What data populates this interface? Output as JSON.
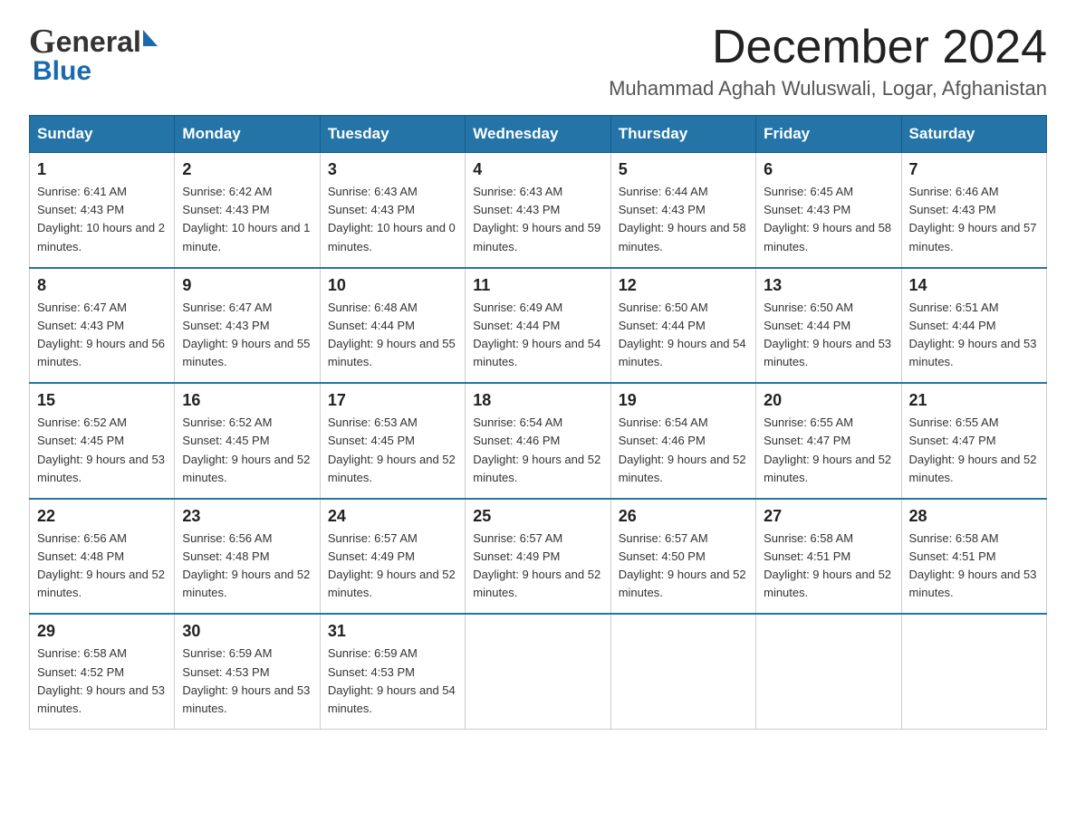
{
  "header": {
    "logo_g": "G",
    "logo_eneral": "eneral",
    "logo_blue": "Blue",
    "month_title": "December 2024",
    "location": "Muhammad Aghah Wuluswali, Logar, Afghanistan"
  },
  "weekdays": [
    "Sunday",
    "Monday",
    "Tuesday",
    "Wednesday",
    "Thursday",
    "Friday",
    "Saturday"
  ],
  "weeks": [
    [
      {
        "day": "1",
        "sunrise": "6:41 AM",
        "sunset": "4:43 PM",
        "daylight": "10 hours and 2 minutes."
      },
      {
        "day": "2",
        "sunrise": "6:42 AM",
        "sunset": "4:43 PM",
        "daylight": "10 hours and 1 minute."
      },
      {
        "day": "3",
        "sunrise": "6:43 AM",
        "sunset": "4:43 PM",
        "daylight": "10 hours and 0 minutes."
      },
      {
        "day": "4",
        "sunrise": "6:43 AM",
        "sunset": "4:43 PM",
        "daylight": "9 hours and 59 minutes."
      },
      {
        "day": "5",
        "sunrise": "6:44 AM",
        "sunset": "4:43 PM",
        "daylight": "9 hours and 58 minutes."
      },
      {
        "day": "6",
        "sunrise": "6:45 AM",
        "sunset": "4:43 PM",
        "daylight": "9 hours and 58 minutes."
      },
      {
        "day": "7",
        "sunrise": "6:46 AM",
        "sunset": "4:43 PM",
        "daylight": "9 hours and 57 minutes."
      }
    ],
    [
      {
        "day": "8",
        "sunrise": "6:47 AM",
        "sunset": "4:43 PM",
        "daylight": "9 hours and 56 minutes."
      },
      {
        "day": "9",
        "sunrise": "6:47 AM",
        "sunset": "4:43 PM",
        "daylight": "9 hours and 55 minutes."
      },
      {
        "day": "10",
        "sunrise": "6:48 AM",
        "sunset": "4:44 PM",
        "daylight": "9 hours and 55 minutes."
      },
      {
        "day": "11",
        "sunrise": "6:49 AM",
        "sunset": "4:44 PM",
        "daylight": "9 hours and 54 minutes."
      },
      {
        "day": "12",
        "sunrise": "6:50 AM",
        "sunset": "4:44 PM",
        "daylight": "9 hours and 54 minutes."
      },
      {
        "day": "13",
        "sunrise": "6:50 AM",
        "sunset": "4:44 PM",
        "daylight": "9 hours and 53 minutes."
      },
      {
        "day": "14",
        "sunrise": "6:51 AM",
        "sunset": "4:44 PM",
        "daylight": "9 hours and 53 minutes."
      }
    ],
    [
      {
        "day": "15",
        "sunrise": "6:52 AM",
        "sunset": "4:45 PM",
        "daylight": "9 hours and 53 minutes."
      },
      {
        "day": "16",
        "sunrise": "6:52 AM",
        "sunset": "4:45 PM",
        "daylight": "9 hours and 52 minutes."
      },
      {
        "day": "17",
        "sunrise": "6:53 AM",
        "sunset": "4:45 PM",
        "daylight": "9 hours and 52 minutes."
      },
      {
        "day": "18",
        "sunrise": "6:54 AM",
        "sunset": "4:46 PM",
        "daylight": "9 hours and 52 minutes."
      },
      {
        "day": "19",
        "sunrise": "6:54 AM",
        "sunset": "4:46 PM",
        "daylight": "9 hours and 52 minutes."
      },
      {
        "day": "20",
        "sunrise": "6:55 AM",
        "sunset": "4:47 PM",
        "daylight": "9 hours and 52 minutes."
      },
      {
        "day": "21",
        "sunrise": "6:55 AM",
        "sunset": "4:47 PM",
        "daylight": "9 hours and 52 minutes."
      }
    ],
    [
      {
        "day": "22",
        "sunrise": "6:56 AM",
        "sunset": "4:48 PM",
        "daylight": "9 hours and 52 minutes."
      },
      {
        "day": "23",
        "sunrise": "6:56 AM",
        "sunset": "4:48 PM",
        "daylight": "9 hours and 52 minutes."
      },
      {
        "day": "24",
        "sunrise": "6:57 AM",
        "sunset": "4:49 PM",
        "daylight": "9 hours and 52 minutes."
      },
      {
        "day": "25",
        "sunrise": "6:57 AM",
        "sunset": "4:49 PM",
        "daylight": "9 hours and 52 minutes."
      },
      {
        "day": "26",
        "sunrise": "6:57 AM",
        "sunset": "4:50 PM",
        "daylight": "9 hours and 52 minutes."
      },
      {
        "day": "27",
        "sunrise": "6:58 AM",
        "sunset": "4:51 PM",
        "daylight": "9 hours and 52 minutes."
      },
      {
        "day": "28",
        "sunrise": "6:58 AM",
        "sunset": "4:51 PM",
        "daylight": "9 hours and 53 minutes."
      }
    ],
    [
      {
        "day": "29",
        "sunrise": "6:58 AM",
        "sunset": "4:52 PM",
        "daylight": "9 hours and 53 minutes."
      },
      {
        "day": "30",
        "sunrise": "6:59 AM",
        "sunset": "4:53 PM",
        "daylight": "9 hours and 53 minutes."
      },
      {
        "day": "31",
        "sunrise": "6:59 AM",
        "sunset": "4:53 PM",
        "daylight": "9 hours and 54 minutes."
      },
      null,
      null,
      null,
      null
    ]
  ],
  "labels": {
    "sunrise_prefix": "Sunrise: ",
    "sunset_prefix": "Sunset: ",
    "daylight_prefix": "Daylight: "
  }
}
